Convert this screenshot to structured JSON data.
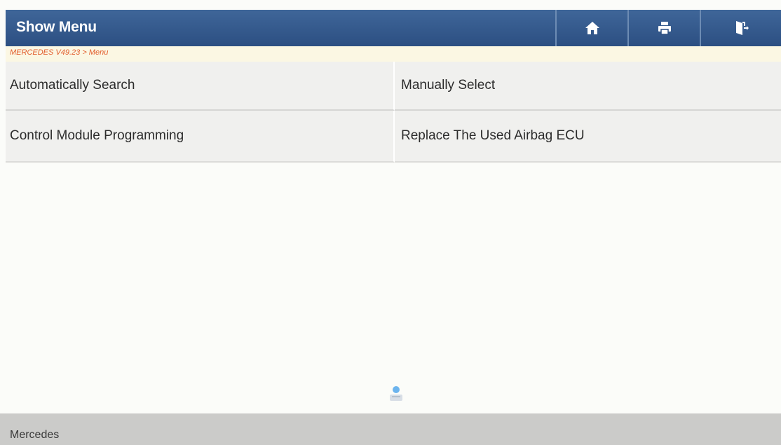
{
  "header": {
    "title": "Show Menu",
    "buttons": [
      {
        "name": "home",
        "icon": "home-icon"
      },
      {
        "name": "print",
        "icon": "printer-icon"
      },
      {
        "name": "exit",
        "icon": "exit-icon"
      }
    ]
  },
  "breadcrumb": "MERCEDES V49.23 > Menu",
  "menu": {
    "items": [
      {
        "label": "Automatically Search"
      },
      {
        "label": "Manually Select"
      },
      {
        "label": "Control Module Programming"
      },
      {
        "label": "Replace The Used Airbag ECU"
      }
    ]
  },
  "loading_indicator": {
    "icon": "loading-icon"
  },
  "footer": {
    "text": "Mercedes"
  },
  "colors": {
    "header_bg": "#345a8d",
    "breadcrumb_text": "#e25c2b",
    "breadcrumb_bg": "#fbf7e3",
    "menu_cell_bg": "#f0f0ee",
    "footer_bg": "#cbcbc9"
  }
}
